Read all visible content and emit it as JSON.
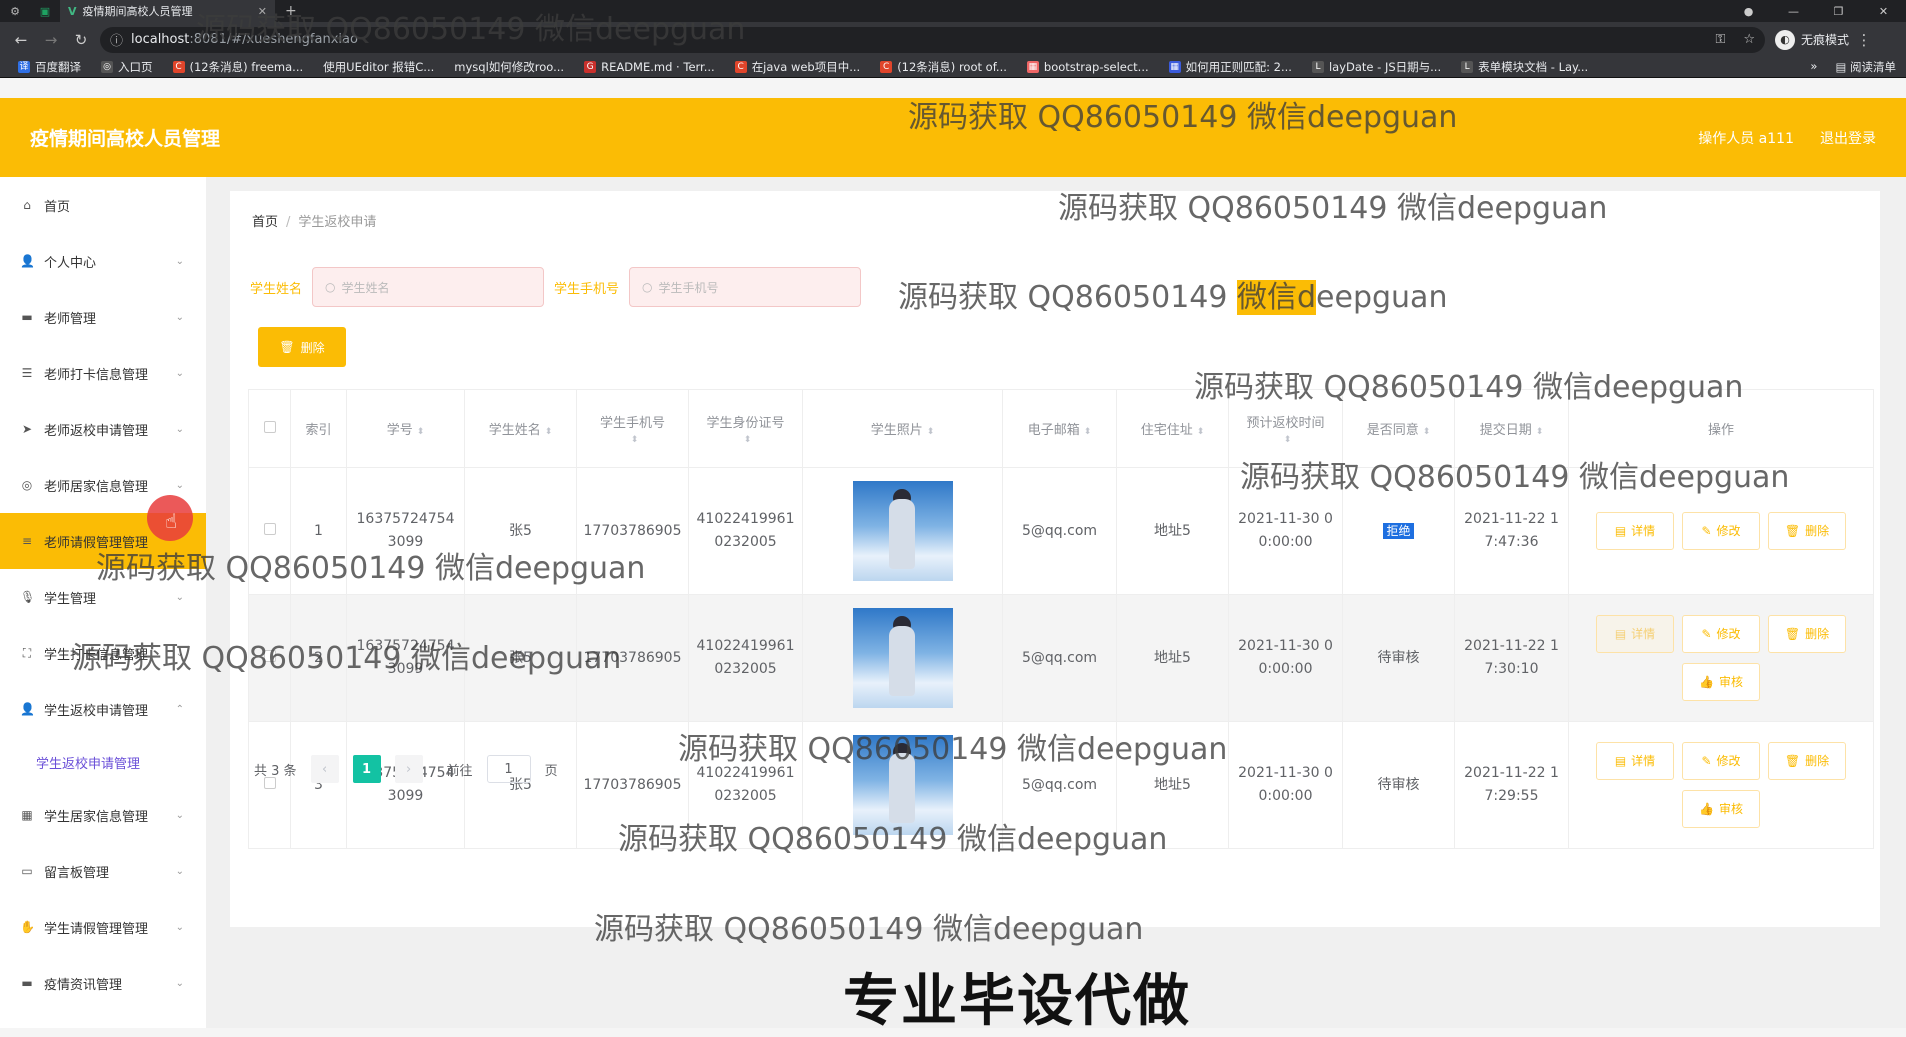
{
  "browser": {
    "tab_title": "疫情期间高校人员管理",
    "url_host": "localhost",
    "url_path": ":8081/#/xueshengfanxiao",
    "incognito_label": "无痕模式",
    "bookmarks": [
      "百度翻译",
      "入口页",
      "(12条消息) freema...",
      "使用UEditor 报错C...",
      "mysql如何修改roo...",
      "README.md · Terr...",
      "在java web项目中...",
      "(12条消息) root of...",
      "bootstrap-select...",
      "如何用正则匹配: 2...",
      "layDate - JS日期与...",
      "表单模块文档 - Lay..."
    ],
    "reading_list": "阅读清单"
  },
  "header": {
    "title": "疫情期间高校人员管理",
    "operator": "操作人员 a111",
    "logout": "退出登录"
  },
  "sidebar": {
    "items": [
      {
        "label": "首页"
      },
      {
        "label": "个人中心"
      },
      {
        "label": "老师管理"
      },
      {
        "label": "老师打卡信息管理"
      },
      {
        "label": "老师返校申请管理"
      },
      {
        "label": "老师居家信息管理"
      },
      {
        "label": "老师请假管理管理"
      },
      {
        "label": "学生管理"
      },
      {
        "label": "学生打卡信息管理"
      },
      {
        "label": "学生返校申请管理"
      },
      {
        "label": "学生居家信息管理"
      },
      {
        "label": "留言板管理"
      },
      {
        "label": "学生请假管理管理"
      },
      {
        "label": "疫情资讯管理"
      }
    ],
    "submenu_label": "学生返校申请管理"
  },
  "breadcrumb": {
    "home": "首页",
    "current": "学生返校申请"
  },
  "search": {
    "name_label": "学生姓名",
    "name_placeholder": "学生姓名",
    "phone_label": "学生手机号",
    "phone_placeholder": "学生手机号"
  },
  "toolbar": {
    "delete_label": "删除"
  },
  "table": {
    "headers": [
      "索引",
      "学号",
      "学生姓名",
      "学生手机号",
      "学生身份证号",
      "学生照片",
      "电子邮箱",
      "住宅住址",
      "预计返校时间",
      "是否同意",
      "提交日期",
      "操作"
    ],
    "rows": [
      {
        "index": "1",
        "student_no": "16375724754\n3099",
        "name": "张5",
        "phone": "17703786905",
        "id_card": "41022419961\n0232005",
        "email": "5@qq.com",
        "address": "地址5",
        "return_time": "2021-11-30 0\n0:00:00",
        "status": "拒绝",
        "submit": "2021-11-22 1\n7:47:36"
      },
      {
        "index": "2",
        "student_no": "16375724754\n3099",
        "name": "张5",
        "phone": "17703786905",
        "id_card": "41022419961\n0232005",
        "email": "5@qq.com",
        "address": "地址5",
        "return_time": "2021-11-30 0\n0:00:00",
        "status": "待审核",
        "submit": "2021-11-22 1\n7:30:10"
      },
      {
        "index": "3",
        "student_no": "16375724754\n3099",
        "name": "张5",
        "phone": "17703786905",
        "id_card": "41022419961\n0232005",
        "email": "5@qq.com",
        "address": "地址5",
        "return_time": "2021-11-30 0\n0:00:00",
        "status": "待审核",
        "submit": "2021-11-22 1\n7:29:55"
      }
    ],
    "ops": {
      "detail": "详情",
      "edit": "修改",
      "delete": "删除",
      "review": "审核"
    }
  },
  "pager": {
    "total": "共 3 条",
    "page": "1",
    "goto_label": "前往",
    "goto_value": "1",
    "page_unit": "页"
  },
  "watermark": "源码获取 QQ86050149 微信deepguan",
  "watermark_hl_a": "源码获取 QQ86050149 ",
  "watermark_hl_b": "微信d",
  "watermark_hl_c": "eepguan",
  "bottom_banner": "专业毕设代做",
  "colors": {
    "accent": "#fbbc05",
    "pager_active": "#13c2a3",
    "reject": "#1e6fe0"
  }
}
